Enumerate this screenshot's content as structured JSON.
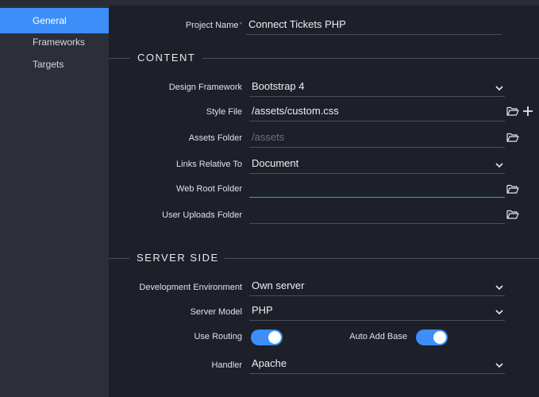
{
  "sidebar": {
    "items": [
      {
        "label": "General"
      },
      {
        "label": "Frameworks"
      },
      {
        "label": "Targets"
      }
    ]
  },
  "project": {
    "label": "Project Name",
    "required_mark": "*",
    "value": "Connect Tickets PHP"
  },
  "content_section": {
    "title": "CONTENT",
    "design_framework": {
      "label": "Design Framework",
      "value": "Bootstrap 4"
    },
    "style_file": {
      "label": "Style File",
      "value": "/assets/custom.css"
    },
    "assets_folder": {
      "label": "Assets Folder",
      "placeholder": "/assets"
    },
    "links_relative_to": {
      "label": "Links Relative To",
      "value": "Document"
    },
    "web_root_folder": {
      "label": "Web Root Folder",
      "value": ""
    },
    "user_uploads_folder": {
      "label": "User Uploads Folder",
      "value": ""
    }
  },
  "server_section": {
    "title": "SERVER SIDE",
    "development_environment": {
      "label": "Development Environment",
      "value": "Own server"
    },
    "server_model": {
      "label": "Server Model",
      "value": "PHP"
    },
    "use_routing": {
      "label": "Use Routing",
      "on": true
    },
    "auto_add_base": {
      "label": "Auto Add Base",
      "on": true
    },
    "handler": {
      "label": "Handler",
      "value": "Apache"
    }
  },
  "icons": {
    "folder": "folder-open-icon",
    "plus": "plus-icon",
    "chevron": "chevron-down-icon"
  },
  "colors": {
    "accent": "#3d8ef8",
    "background": "#1d2029",
    "sidebar": "#2c2f3a"
  }
}
